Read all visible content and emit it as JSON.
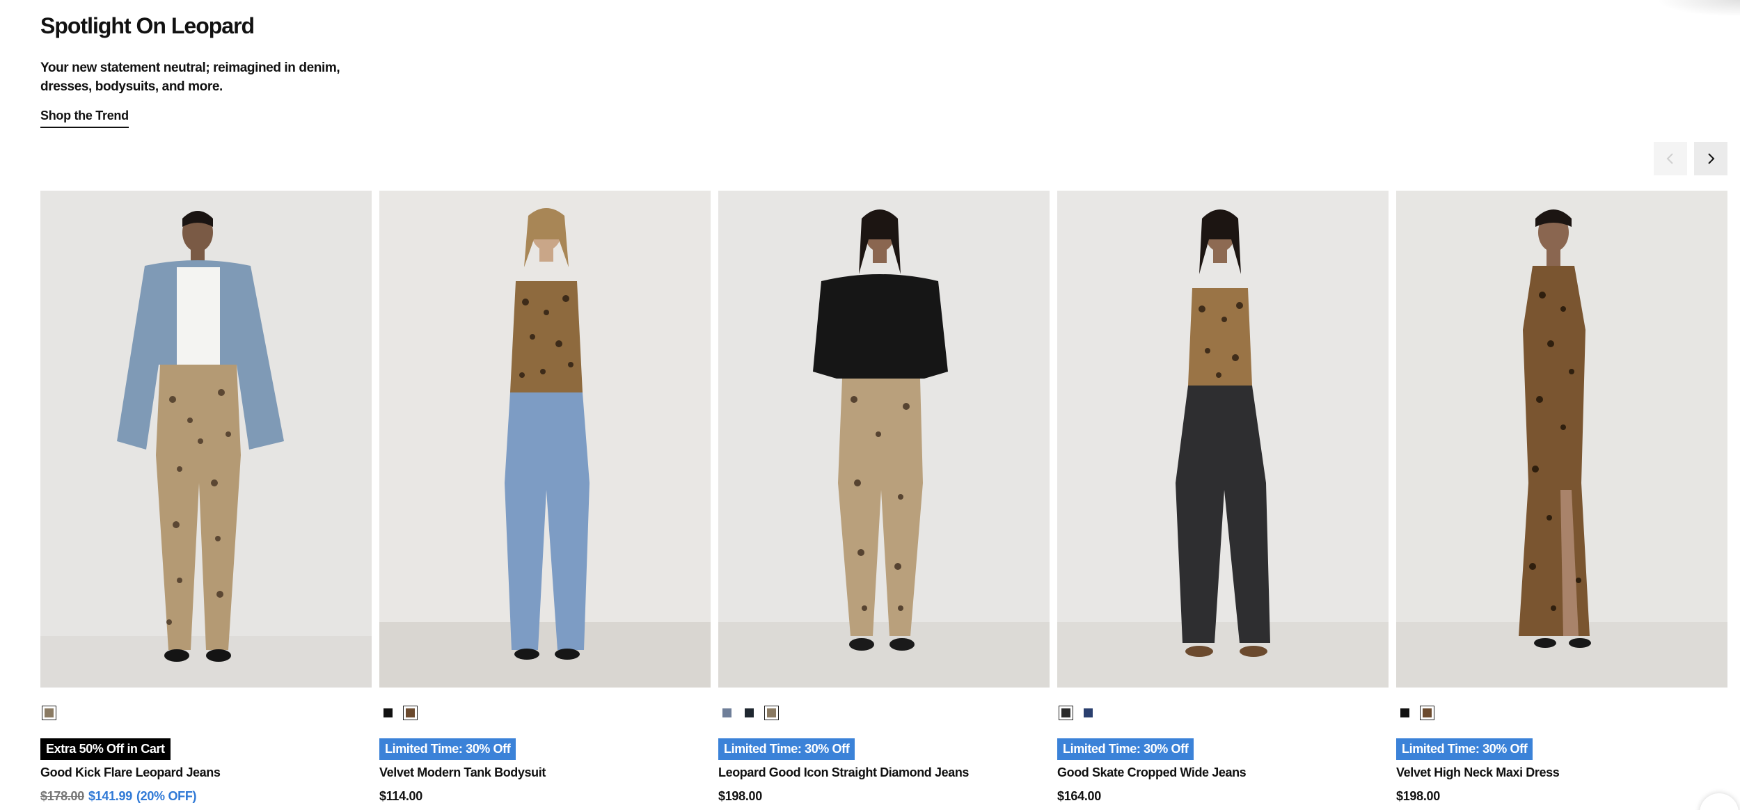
{
  "hero": {
    "title": "Spotlight On Leopard",
    "subtitle": "Your new statement neutral; reimagined in denim, dresses, bodysuits, and more.",
    "cta": "Shop the Trend"
  },
  "carousel": {
    "prev_icon": "chevron-left-icon",
    "next_icon": "chevron-right-icon",
    "prev_disabled": true
  },
  "colors": {
    "sale_blue": "#3b82d8",
    "price_blue": "#2f79d6",
    "badge_black": "#000000",
    "image_bg": "#e5e4e2"
  },
  "products": [
    {
      "name": "Good Kick Flare Leopard Jeans",
      "badge": "Extra 50% Off in Cart",
      "badge_style": "black",
      "price_original": "$178.00",
      "price_sale": "$141.99",
      "discount": "(20% OFF)",
      "swatches": [
        {
          "color": "#8a7a62",
          "selected": true
        }
      ],
      "image": "model-leopard-jeans-denim-jacket"
    },
    {
      "name": "Velvet Modern Tank Bodysuit",
      "badge": "Limited Time: 30% Off",
      "badge_style": "blue",
      "price": "$114.00",
      "swatches": [
        {
          "color": "#111111",
          "selected": false
        },
        {
          "color": "#6b4a2e",
          "selected": true
        }
      ],
      "image": "model-leopard-bodysuit-blue-jeans"
    },
    {
      "name": "Leopard Good Icon Straight Diamond Jeans",
      "badge": "Limited Time: 30% Off",
      "badge_style": "blue",
      "price": "$198.00",
      "swatches": [
        {
          "color": "#6f7f99",
          "selected": false
        },
        {
          "color": "#1f2730",
          "selected": false
        },
        {
          "color": "#8a7a62",
          "selected": true
        }
      ],
      "image": "model-black-tee-leopard-jeans"
    },
    {
      "name": "Good Skate Cropped Wide Jeans",
      "badge": "Limited Time: 30% Off",
      "badge_style": "blue",
      "price": "$164.00",
      "swatches": [
        {
          "color": "#2a2a2a",
          "selected": true
        },
        {
          "color": "#2a3f6e",
          "selected": false
        }
      ],
      "image": "model-leopard-tank-black-jeans"
    },
    {
      "name": "Velvet High Neck Maxi Dress",
      "badge": "Limited Time: 30% Off",
      "badge_style": "blue",
      "price": "$198.00",
      "swatches": [
        {
          "color": "#111111",
          "selected": false
        },
        {
          "color": "#6b4a2e",
          "selected": true
        }
      ],
      "image": "model-leopard-maxi-dress"
    }
  ]
}
